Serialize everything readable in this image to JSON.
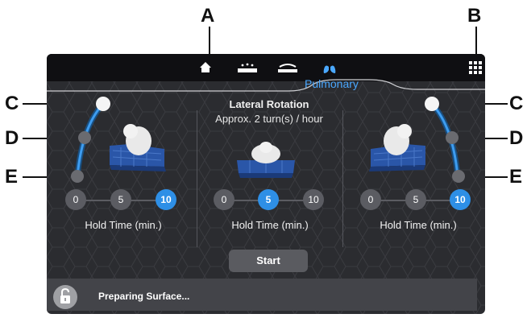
{
  "callouts": {
    "a": "A",
    "b": "B",
    "c_left": "C",
    "c_right": "C",
    "d_left": "D",
    "d_right": "D",
    "e_left": "E",
    "e_right": "E"
  },
  "topbar": {
    "active_tab_label": "Pulmonary",
    "icons": [
      "home-icon",
      "bed-surface-icon",
      "rotation-icon",
      "lungs-icon",
      "grid-menu-icon"
    ]
  },
  "colors": {
    "accent": "#2e8fe6",
    "active_icon": "#4aa8ff",
    "background": "#2b2c30"
  },
  "center": {
    "title": "Lateral Rotation",
    "subtitle": "Approx. 2 turn(s) / hour"
  },
  "left_panel": {
    "options": [
      "0",
      "5",
      "10"
    ],
    "selected": "10",
    "hold_label": "Hold Time (min.)"
  },
  "center_panel": {
    "options": [
      "0",
      "5",
      "10"
    ],
    "selected": "5",
    "hold_label": "Hold Time (min.)"
  },
  "right_panel": {
    "options": [
      "0",
      "5",
      "10"
    ],
    "selected": "10",
    "hold_label": "Hold Time (min.)"
  },
  "start_label": "Start",
  "status": {
    "text": "Preparing Surface...",
    "icon": "unlock-icon"
  }
}
